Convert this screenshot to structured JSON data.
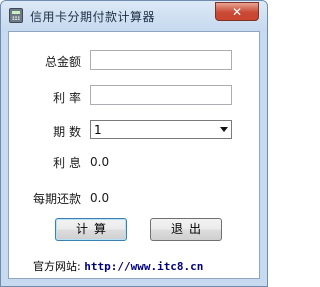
{
  "window": {
    "title": "信用卡分期付款计算器",
    "close_label": "✕"
  },
  "form": {
    "total_label": "总金额",
    "total_value": "",
    "rate_label": "利 率",
    "rate_value": "",
    "periods_label": "期 数",
    "periods_selected": "1",
    "interest_label": "利 息",
    "interest_value": "0.0",
    "installment_label": "每期还款",
    "installment_value": "0.0"
  },
  "buttons": {
    "calculate_label": "计算",
    "exit_label": "退出"
  },
  "footer": {
    "site_label": "官方网站:",
    "site_url": "http://www.itc8.cn"
  },
  "icons": {
    "app": "calculator-icon",
    "close": "close-icon"
  }
}
